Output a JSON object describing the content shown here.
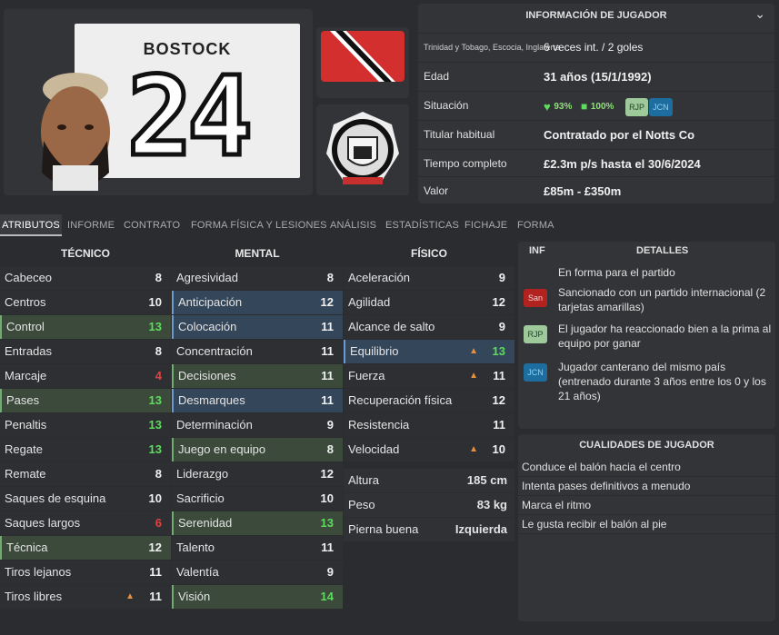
{
  "player": {
    "name": "BOSTOCK",
    "number": "24"
  },
  "info": {
    "header": "INFORMACIÓN DE JUGADOR",
    "nations": "Trinidad y Tobago, Escocia, Inglaterra",
    "caps": "6 veces int. / 2 goles",
    "age_label": "Edad",
    "age_value": "31 años (15/1/1992)",
    "status_label": "Situación",
    "fitness": "93%",
    "match": "100%",
    "badge1": "RJP",
    "badge2": "JCN",
    "squad_label": "Titular habitual",
    "squad_value": "Contratado por el Notts Co",
    "contract_label": "Tiempo completo",
    "contract_value": "£2.3m p/s hasta el 30/6/2024",
    "value_label": "Valor",
    "value_value": "£85m - £350m"
  },
  "tabs": [
    "ATRIBUTOS",
    "INFORME",
    "CONTRATO",
    "FORMA FÍSICA Y LESIONES",
    "ANÁLISIS",
    "ESTADÍSTICAS",
    "FICHAJE",
    "FORMA"
  ],
  "headers": {
    "tecnico": "TÉCNICO",
    "mental": "MENTAL",
    "fisico": "FÍSICO"
  },
  "tecnico": [
    {
      "n": "Cabeceo",
      "v": "8"
    },
    {
      "n": "Centros",
      "v": "10"
    },
    {
      "n": "Control",
      "v": "13"
    },
    {
      "n": "Entradas",
      "v": "8"
    },
    {
      "n": "Marcaje",
      "v": "4"
    },
    {
      "n": "Pases",
      "v": "13"
    },
    {
      "n": "Penaltis",
      "v": "13"
    },
    {
      "n": "Regate",
      "v": "13"
    },
    {
      "n": "Remate",
      "v": "8"
    },
    {
      "n": "Saques de esquina",
      "v": "10"
    },
    {
      "n": "Saques largos",
      "v": "6"
    },
    {
      "n": "Técnica",
      "v": "12"
    },
    {
      "n": "Tiros lejanos",
      "v": "11"
    },
    {
      "n": "Tiros libres",
      "v": "11"
    }
  ],
  "mental": [
    {
      "n": "Agresividad",
      "v": "8"
    },
    {
      "n": "Anticipación",
      "v": "12"
    },
    {
      "n": "Colocación",
      "v": "11"
    },
    {
      "n": "Concentración",
      "v": "11"
    },
    {
      "n": "Decisiones",
      "v": "11"
    },
    {
      "n": "Desmarques",
      "v": "11"
    },
    {
      "n": "Determinación",
      "v": "9"
    },
    {
      "n": "Juego en equipo",
      "v": "8"
    },
    {
      "n": "Liderazgo",
      "v": "12"
    },
    {
      "n": "Sacrificio",
      "v": "10"
    },
    {
      "n": "Serenidad",
      "v": "13"
    },
    {
      "n": "Talento",
      "v": "11"
    },
    {
      "n": "Valentía",
      "v": "9"
    },
    {
      "n": "Visión",
      "v": "14"
    }
  ],
  "fisico": [
    {
      "n": "Aceleración",
      "v": "9"
    },
    {
      "n": "Agilidad",
      "v": "12"
    },
    {
      "n": "Alcance de salto",
      "v": "9"
    },
    {
      "n": "Equilibrio",
      "v": "13"
    },
    {
      "n": "Fuerza",
      "v": "11"
    },
    {
      "n": "Recuperación física",
      "v": "12"
    },
    {
      "n": "Resistencia",
      "v": "11"
    },
    {
      "n": "Velocidad",
      "v": "10"
    }
  ],
  "physical": {
    "height_label": "Altura",
    "height": "185 cm",
    "weight_label": "Peso",
    "weight": "83 kg",
    "foot_label": "Pierna buena",
    "foot": "Izquierda"
  },
  "details": {
    "inf": "INF",
    "title": "DETALLES",
    "items": [
      {
        "icon": "",
        "text": "En forma para el partido"
      },
      {
        "icon": "San",
        "text": "Sancionado con un partido internacional (2 tarjetas amarillas)"
      },
      {
        "icon": "RJP",
        "text": "El jugador ha reaccionado bien a la prima al equipo por ganar"
      },
      {
        "icon": "JCN",
        "text": "Jugador canterano del mismo país (entrenado durante 3 años entre los 0 y los 21 años)"
      }
    ]
  },
  "qualities": {
    "title": "CUALIDADES DE JUGADOR",
    "items": [
      "Conduce el balón hacia el centro",
      "Intenta pases definitivos a menudo",
      "Marca el ritmo",
      "Le gusta recibir el balón al pie"
    ]
  },
  "colors": {
    "green": "#5ddc5d",
    "red": "#e54040",
    "accent": "#e88f3e"
  }
}
